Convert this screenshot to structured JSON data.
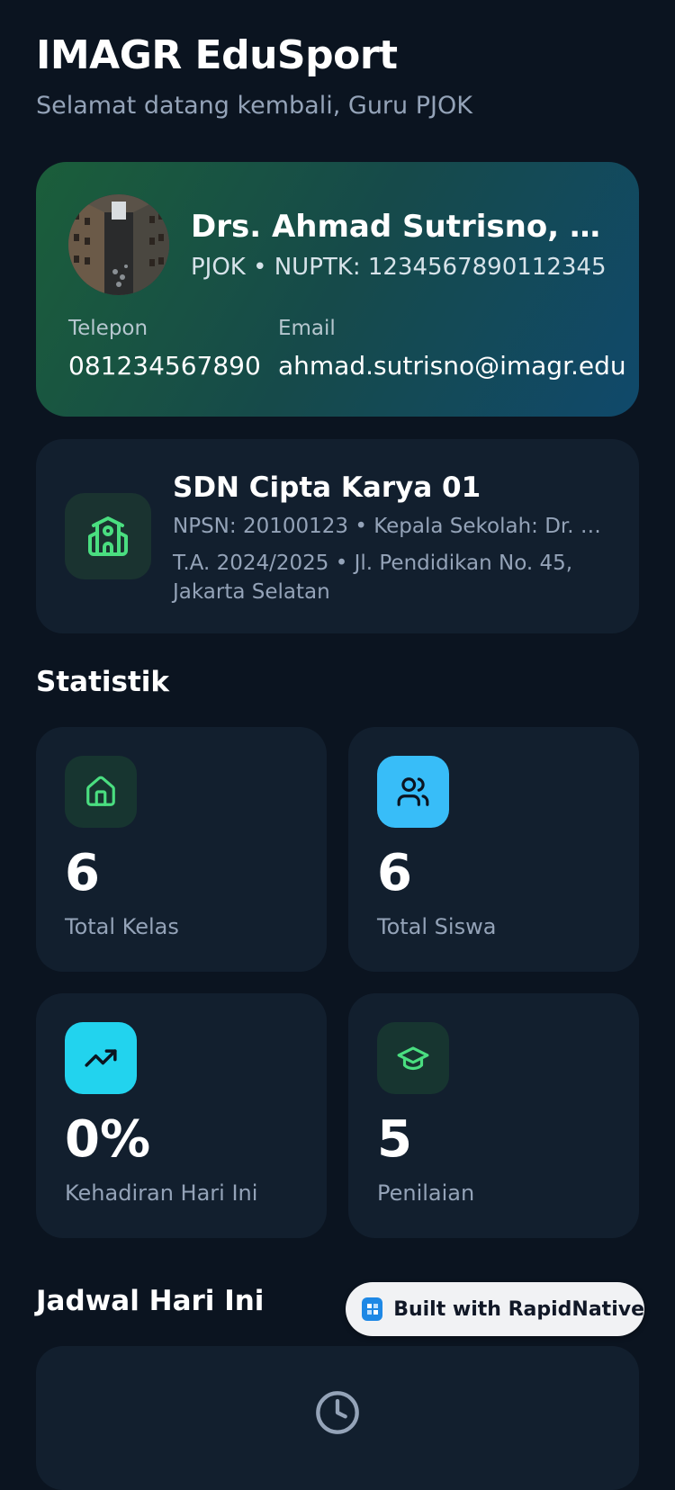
{
  "header": {
    "title": "IMAGR EduSport",
    "subtitle": "Selamat datang kembali, Guru PJOK"
  },
  "profile": {
    "avatar_icon": "avatar-photo",
    "name": "Drs. Ahmad Sutrisno, S....",
    "role": "PJOK • NUPTK: 1234567890112345",
    "phone_label": "Telepon",
    "phone": "081234567890",
    "email_label": "Email",
    "email": "ahmad.sutrisno@imagr.edu"
  },
  "school": {
    "icon": "school-icon",
    "name": "SDN Cipta Karya 01",
    "line1": "NPSN: 20100123 • Kepala Sekolah: Dr. Ba...",
    "line2": "T.A. 2024/2025 • Jl. Pendidikan No. 45, Jakarta Selatan"
  },
  "stats": {
    "title": "Statistik",
    "items": [
      {
        "icon": "home-icon",
        "value": "6",
        "label": "Total Kelas",
        "icon_bg": "#173530",
        "icon_color": "#4ade80"
      },
      {
        "icon": "users-icon",
        "value": "6",
        "label": "Total Siswa",
        "icon_bg": "#38bdf8",
        "icon_color": "#0b1420"
      },
      {
        "icon": "trending-up-icon",
        "value": "0%",
        "label": "Kehadiran Hari Ini",
        "icon_bg": "#22d3ee",
        "icon_color": "#0b1420"
      },
      {
        "icon": "graduation-cap-icon",
        "value": "5",
        "label": "Penilaian",
        "icon_bg": "#173530",
        "icon_color": "#4ade80"
      }
    ]
  },
  "schedule": {
    "title": "Jadwal Hari Ini",
    "icon": "clock-icon"
  },
  "badge": {
    "label": "Built with RapidNative"
  },
  "colors": {
    "background": "#0b1420",
    "card": "#121f2e",
    "accent_green": "#4ade80",
    "muted_text": "#94a3b8"
  }
}
